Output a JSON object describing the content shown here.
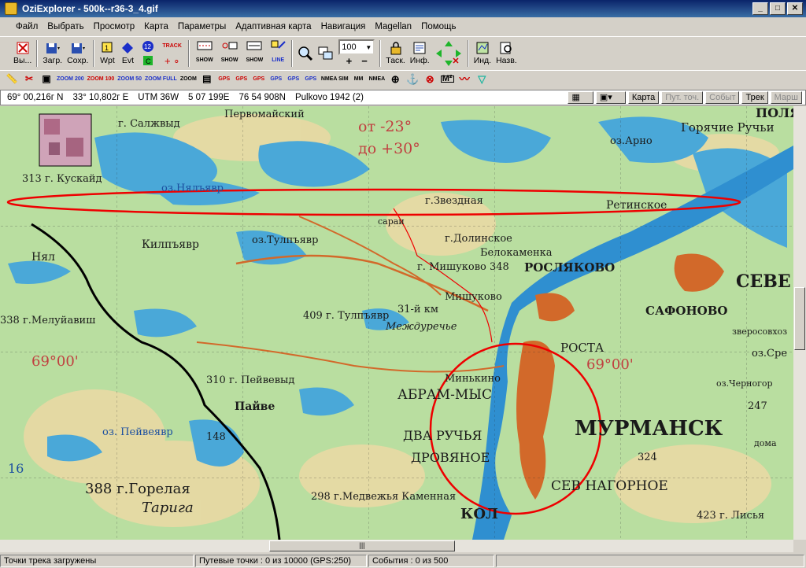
{
  "window": {
    "title": "OziExplorer - 500k--r36-3_4.gif"
  },
  "menu": [
    "Файл",
    "Выбрать",
    "Просмотр",
    "Карта",
    "Параметры",
    "Адаптивная карта",
    "Навигация",
    "Magellan",
    "Помощь"
  ],
  "toolbar1": {
    "exit_label": "Вы...",
    "load_label": "Загр.",
    "save_label": "Сохр.",
    "wpt_label": "Wpt",
    "evt_label": "Evt",
    "track_label": "TRACK",
    "show_label": "SHOW",
    "line_label": "LINE",
    "zoom_value": "100",
    "task_label": "Таск.",
    "info_label": "Инф.",
    "ind_label": "Инд.",
    "name_label": "Назв."
  },
  "toolbar2": {
    "zoom200": "ZOOM 200",
    "zoom100": "ZOOM 100",
    "zoom50": "ZOOM 50",
    "zoomfull": "ZOOM FULL",
    "zoom_generic": "ZOOM",
    "gps": "GPS",
    "nmea_sim": "NMEA SIM",
    "mm": "MM",
    "nmea": "NMEA"
  },
  "coords": {
    "lat": "69° 00,216г N",
    "lon": "33° 10,802г E",
    "utm": "UTM  36W",
    "easting": "5 07 199E",
    "northing": "76 54 908N",
    "datum": "Pulkovo 1942 (2)"
  },
  "coord_buttons": {
    "map": "Карта",
    "points": "Пут. точ.",
    "events": "Событ",
    "track": "Трек",
    "routes": "Марш"
  },
  "map": {
    "labels": {
      "salzhvyd": "г. Салжвыд",
      "pervomaysky": "Первомайский",
      "ot": "от -23°",
      "do": "до +30°",
      "goryachie": "Горячие Ручьи",
      "arno": "оз.Арно",
      "polyar": "ПОЛЯ",
      "kuskaid": "313 г. Кускайд",
      "nyaljavr": "оз.Нялъявр",
      "zvezdnaya": "г.Звездная",
      "retinskoe": "Ретинское",
      "sarai": "сараи",
      "dolinskoe": "г.Долинское",
      "belokamenka": "Белокаменка",
      "kilpjavr": "Килпъявр",
      "nyal": "Нял",
      "tulpjavr": "оз.Тулпъявр",
      "mishukovo348": "г. Мишуково 348",
      "roslyakovo": "РОСЛЯКОВО",
      "safonovo": "САФОНОВО",
      "severo": "СЕВЕ",
      "mishukovo": "Мишуково",
      "melujavish": "338 г.Мелуйавиш",
      "tulpjavr_g": "409 г. Тулпъявр",
      "km31": "31-й км",
      "mezhdureche": "Междуречье",
      "rosta": "РОСТА",
      "zverosovhoz": "зверосовхоз",
      "lat6900": "69°00'",
      "pejvevyd": "310 г. Пейвевыд",
      "pajve": "Пайве",
      "abram_mys": "АБРАМ-МЫС",
      "minkino": "Минькино",
      "murmansk": "МУРМАНСК",
      "dva_ruchya": "ДВА РУЧЬЯ",
      "drovyanoe": "ДРОВЯНОЕ",
      "pejvejavr": "оз. Пейвеявр",
      "h148": "148",
      "h324": "324",
      "h247": "247",
      "goralaya": "388  г.Горелая",
      "tariga": "Тарига",
      "medvezhya": "298 г.Медвежья Каменная",
      "kola": "КОЛ",
      "sev_nagornoe": "СЕВ НАГОРНОЕ",
      "lisya": "423 г. Лисья",
      "h16": "16",
      "doma": "дома",
      "ozero_sred": "оз.Сре",
      "chernogor": "оз.Черногор"
    }
  },
  "status": {
    "track_loaded": "Точки трека загружены",
    "waypoints": "Путевые точки : 0 из 10000  (GPS:250)",
    "events": "События : 0 из 500"
  }
}
